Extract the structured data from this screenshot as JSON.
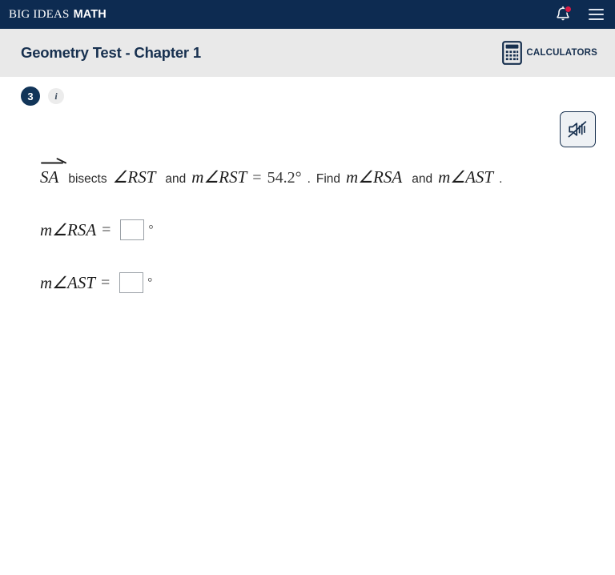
{
  "topbar": {
    "brand_primary": "BIG IDEAS",
    "brand_secondary": "MATH",
    "notifications_icon": "bell-icon",
    "menu_icon": "hamburger-menu-icon",
    "badge_color": "#d81b45",
    "background_color": "#0d2b51"
  },
  "title_bar": {
    "title": "Geometry Test - Chapter 1",
    "calculators_label": "CALCULATORS",
    "calculator_icon": "calculator-icon",
    "background_color": "#e9e9e9",
    "text_color": "#17304f"
  },
  "question": {
    "number": "3",
    "info_label": "i",
    "audio_icon": "speaker-muted-icon",
    "statement": {
      "ray_label": "SA",
      "bisects_text": "bisects",
      "angle_rst": "∠RST",
      "and_text_1": "and",
      "measure_rst": "m∠RST",
      "equals": "=",
      "given_value": "54.2°",
      "period_1": ".",
      "find_text": "Find",
      "measure_rsa": "m∠RSA",
      "and_text_2": "and",
      "measure_ast": "m∠AST",
      "period_2": "."
    },
    "answers": [
      {
        "label": "m∠RSA",
        "equals": "=",
        "value": "",
        "placeholder": "",
        "unit": "°"
      },
      {
        "label": "m∠AST",
        "equals": "=",
        "value": "",
        "placeholder": "",
        "unit": "°"
      }
    ]
  }
}
